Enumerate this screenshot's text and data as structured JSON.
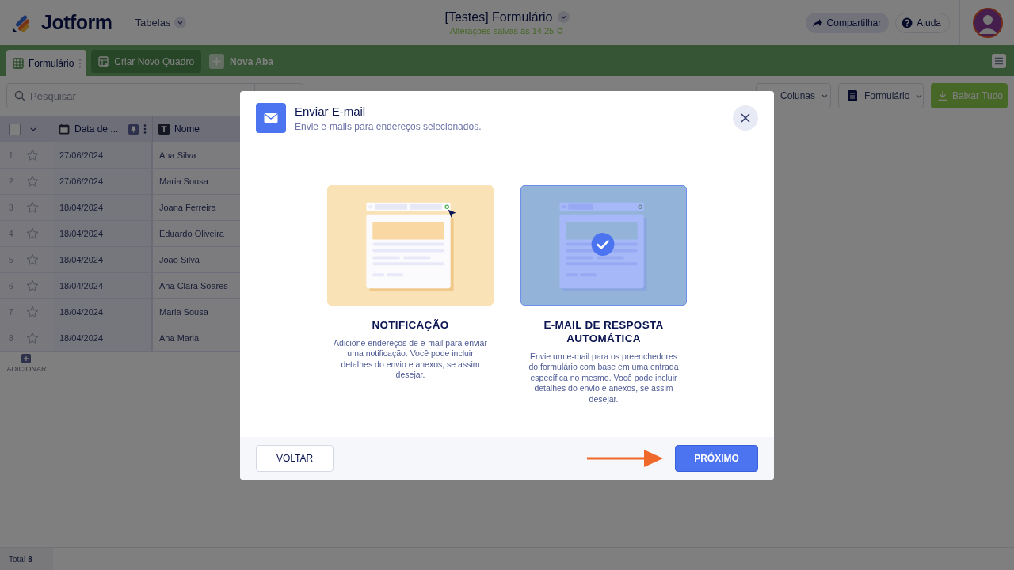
{
  "header": {
    "brand": "Jotform",
    "section": "Tabelas",
    "title": "[Testes] Formulário",
    "save_status": "Alterações salvas às 14:25",
    "share": "Compartilhar",
    "help": "Ajuda"
  },
  "tabs": [
    {
      "label": "Formulário",
      "selected": true
    }
  ],
  "tab_actions": {
    "create_board": "Criar Novo Quadro",
    "new_tab": "Nova Aba"
  },
  "toolbar": {
    "search": {
      "placeholder": "Pesquisar"
    },
    "columns": "Colunas",
    "form": "Formulário",
    "download": "Baixar Tudo"
  },
  "table": {
    "all_selected": false,
    "columns": [
      {
        "label": "Data de ...",
        "kind": "date"
      },
      {
        "label": "Nome",
        "kind": "text"
      }
    ],
    "rows": [
      {
        "number": "1",
        "starred": false,
        "cells": [
          "27/06/2024",
          "Ana Silva"
        ]
      },
      {
        "number": "2",
        "starred": false,
        "cells": [
          "27/06/2024",
          "Maria Sousa"
        ]
      },
      {
        "number": "3",
        "starred": false,
        "cells": [
          "18/04/2024",
          "Joana Ferreira"
        ]
      },
      {
        "number": "4",
        "starred": false,
        "cells": [
          "18/04/2024",
          "Eduardo Oliveira"
        ]
      },
      {
        "number": "5",
        "starred": false,
        "cells": [
          "18/04/2024",
          "João Silva"
        ]
      },
      {
        "number": "6",
        "starred": false,
        "cells": [
          "18/04/2024",
          "Ana Clara Soares"
        ]
      },
      {
        "number": "7",
        "starred": false,
        "cells": [
          "18/04/2024",
          "Maria Sousa"
        ]
      },
      {
        "number": "8",
        "starred": false,
        "cells": [
          "18/04/2024",
          "Ana Maria"
        ]
      }
    ],
    "add": "ADICIONAR"
  },
  "footer": {
    "label": "Total",
    "count": "8"
  },
  "dialog": {
    "title": "Enviar E-mail",
    "subtitle": "Envie e-mails para endereços selecionados.",
    "options": [
      {
        "kind": "notification",
        "title": "NOTIFICAÇÃO",
        "description": "Adicione endereços de e-mail para enviar uma notificação. Você pode incluir detalhes do envio e anexos, se assim desejar.",
        "selected": false
      },
      {
        "kind": "autoresponder",
        "title": "E-MAIL DE RESPOSTA AUTOMÁTICA",
        "description": "Envie um e-mail para os preenchedores do formulário com base em uma entrada específica no mesmo. Você pode incluir detalhes do envio e anexos, se assim desejar.",
        "selected": true
      }
    ],
    "back": "VOLTAR",
    "next": "PRÓXIMO"
  }
}
